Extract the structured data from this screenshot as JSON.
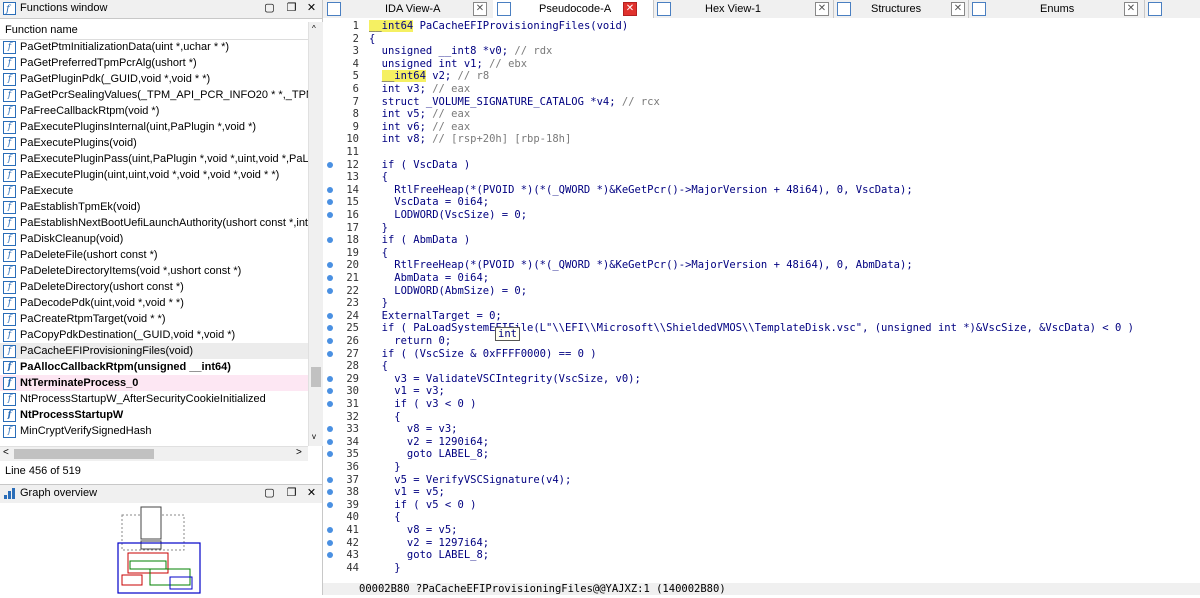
{
  "functions_window": {
    "title": "Functions window",
    "column_header": "Function name",
    "items": [
      {
        "label": "PaGetPtmInitializationData(uint *,uchar * *)",
        "style": ""
      },
      {
        "label": "PaGetPreferredTpmPcrAlg(ushort *)",
        "style": ""
      },
      {
        "label": "PaGetPluginPdk(_GUID,void *,void * *)",
        "style": ""
      },
      {
        "label": "PaGetPcrSealingValues(_TPM_API_PCR_INFO20 * *,_TPM_API_PCI",
        "style": ""
      },
      {
        "label": "PaFreeCallbackRtpm(void *)",
        "style": ""
      },
      {
        "label": "PaExecutePluginsInternal(uint,PaPlugin *,void *)",
        "style": ""
      },
      {
        "label": "PaExecutePlugins(void)",
        "style": ""
      },
      {
        "label": "PaExecutePluginPass(uint,PaPlugin *,void *,uint,void *,PaLoadec",
        "style": ""
      },
      {
        "label": "PaExecutePlugin(uint,uint,void *,void *,void *,void * *)",
        "style": ""
      },
      {
        "label": "PaExecute",
        "style": ""
      },
      {
        "label": "PaEstablishTpmEk(void)",
        "style": ""
      },
      {
        "label": "PaEstablishNextBootUefiLaunchAuthority(ushort const *,int)",
        "style": ""
      },
      {
        "label": "PaDiskCleanup(void)",
        "style": ""
      },
      {
        "label": "PaDeleteFile(ushort const *)",
        "style": ""
      },
      {
        "label": "PaDeleteDirectoryItems(void *,ushort const *)",
        "style": ""
      },
      {
        "label": "PaDeleteDirectory(ushort const *)",
        "style": ""
      },
      {
        "label": "PaDecodePdk(uint,void *,void * *)",
        "style": ""
      },
      {
        "label": "PaCreateRtpmTarget(void * *)",
        "style": ""
      },
      {
        "label": "PaCopyPdkDestination(_GUID,void *,void *)",
        "style": ""
      },
      {
        "label": "PaCacheEFIProvisioningFiles(void)",
        "style": "sel"
      },
      {
        "label": "PaAllocCallbackRtpm(unsigned __int64)",
        "style": "bold"
      },
      {
        "label": "NtTerminateProcess_0",
        "style": "bold pink"
      },
      {
        "label": "NtProcessStartupW_AfterSecurityCookieInitialized",
        "style": ""
      },
      {
        "label": "NtProcessStartupW",
        "style": "bold"
      },
      {
        "label": "MinCryptVerifySignedHash",
        "style": ""
      }
    ],
    "status": "Line 456 of 519"
  },
  "graph_overview": {
    "title": "Graph overview"
  },
  "tabs": [
    {
      "label": "IDA View-A",
      "close": "normal"
    },
    {
      "label": "Pseudocode-A",
      "close": "red"
    },
    {
      "label": "Hex View-1",
      "close": "normal"
    },
    {
      "label": "Structures",
      "close": "normal"
    },
    {
      "label": "Enums",
      "close": "normal"
    }
  ],
  "tooltip": "int",
  "code": {
    "lines": [
      {
        "n": "1",
        "dot": false,
        "html": "<span class='hl'>__int64</span> PaCacheEFIProvisioningFiles(void)"
      },
      {
        "n": "2",
        "dot": false,
        "html": "{"
      },
      {
        "n": "3",
        "dot": false,
        "html": "  unsigned __int8 *v0; <span class='cm'>// rdx</span>"
      },
      {
        "n": "4",
        "dot": false,
        "html": "  unsigned int v1; <span class='cm'>// ebx</span>"
      },
      {
        "n": "5",
        "dot": false,
        "html": "  <span class='hl'>__int64</span> v2; <span class='cm'>// r8</span>"
      },
      {
        "n": "6",
        "dot": false,
        "html": "  int v3; <span class='cm'>// eax</span>"
      },
      {
        "n": "7",
        "dot": false,
        "html": "  struct _VOLUME_SIGNATURE_CATALOG *v4; <span class='cm'>// rcx</span>"
      },
      {
        "n": "8",
        "dot": false,
        "html": "  int v5; <span class='cm'>// eax</span>"
      },
      {
        "n": "9",
        "dot": false,
        "html": "  int v6; <span class='cm'>// eax</span>"
      },
      {
        "n": "10",
        "dot": false,
        "html": "  int v8; <span class='cm'>// [rsp+20h] [rbp-18h]</span>"
      },
      {
        "n": "11",
        "dot": false,
        "html": ""
      },
      {
        "n": "12",
        "dot": true,
        "html": "  if ( VscData )"
      },
      {
        "n": "13",
        "dot": false,
        "html": "  {"
      },
      {
        "n": "14",
        "dot": true,
        "html": "    RtlFreeHeap(*(PVOID *)(*(_QWORD *)&amp;KeGetPcr()-&gt;MajorVersion + 48i64), 0, VscData);"
      },
      {
        "n": "15",
        "dot": true,
        "html": "    VscData = 0i64;"
      },
      {
        "n": "16",
        "dot": true,
        "html": "    LODWORD(VscSize) = 0;"
      },
      {
        "n": "17",
        "dot": false,
        "html": "  }"
      },
      {
        "n": "18",
        "dot": true,
        "html": "  if ( AbmData )"
      },
      {
        "n": "19",
        "dot": false,
        "html": "  {"
      },
      {
        "n": "20",
        "dot": true,
        "html": "    RtlFreeHeap(*(PVOID *)(*(_QWORD *)&amp;KeGetPcr()-&gt;MajorVersion + 48i64), 0, AbmData);"
      },
      {
        "n": "21",
        "dot": true,
        "html": "    AbmData = 0i64;"
      },
      {
        "n": "22",
        "dot": true,
        "html": "    LODWORD(AbmSize) = 0;"
      },
      {
        "n": "23",
        "dot": false,
        "html": "  }"
      },
      {
        "n": "24",
        "dot": true,
        "html": "  ExternalTarget = 0;"
      },
      {
        "n": "25",
        "dot": true,
        "html": "  if ( PaLoadSystemEFIFile(L\"\\\\EFI\\\\Microsoft\\\\ShieldedVMOS\\\\TemplateDisk.vsc\", (unsigned int *)&amp;VscSize, &amp;VscData) &lt; 0 )"
      },
      {
        "n": "26",
        "dot": true,
        "html": "    return 0;"
      },
      {
        "n": "27",
        "dot": true,
        "html": "  if ( (VscSize &amp; 0xFFFF0000) == 0 )"
      },
      {
        "n": "28",
        "dot": false,
        "html": "  {"
      },
      {
        "n": "29",
        "dot": true,
        "html": "    v3 = ValidateVSCIntegrity(VscSize, v0);"
      },
      {
        "n": "30",
        "dot": true,
        "html": "    v1 = v3;"
      },
      {
        "n": "31",
        "dot": true,
        "html": "    if ( v3 &lt; 0 )"
      },
      {
        "n": "32",
        "dot": false,
        "html": "    {"
      },
      {
        "n": "33",
        "dot": true,
        "html": "      v8 = v3;"
      },
      {
        "n": "34",
        "dot": true,
        "html": "      v2 = 1290i64;"
      },
      {
        "n": "35",
        "dot": true,
        "html": "      goto LABEL_8;"
      },
      {
        "n": "36",
        "dot": false,
        "html": "    }"
      },
      {
        "n": "37",
        "dot": true,
        "html": "    v5 = VerifyVSCSignature(v4);"
      },
      {
        "n": "38",
        "dot": true,
        "html": "    v1 = v5;"
      },
      {
        "n": "39",
        "dot": true,
        "html": "    if ( v5 &lt; 0 )"
      },
      {
        "n": "40",
        "dot": false,
        "html": "    {"
      },
      {
        "n": "41",
        "dot": true,
        "html": "      v8 = v5;"
      },
      {
        "n": "42",
        "dot": true,
        "html": "      v2 = 1297i64;"
      },
      {
        "n": "43",
        "dot": true,
        "html": "      goto LABEL_8;"
      },
      {
        "n": "44",
        "dot": false,
        "html": "    }"
      }
    ],
    "footer": "00002B80 ?PaCacheEFIProvisioningFiles@@YAJXZ:1 (140002B80)"
  }
}
